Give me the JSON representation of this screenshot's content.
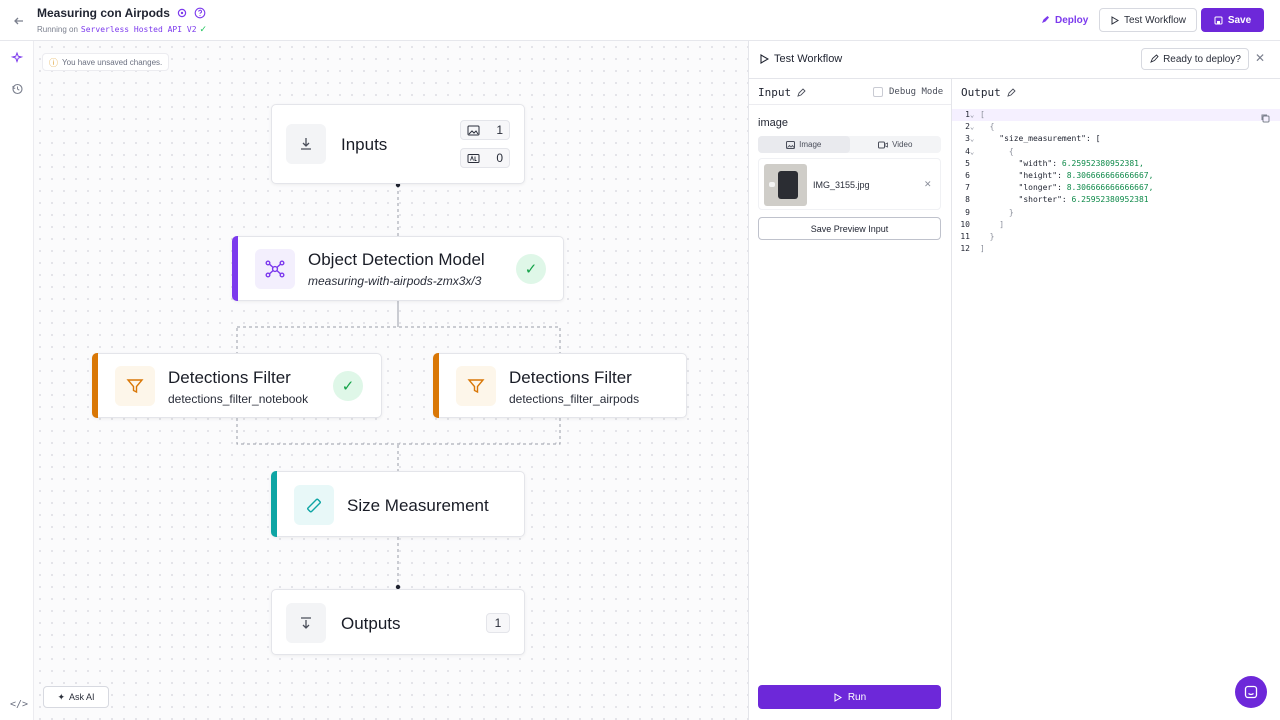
{
  "header": {
    "title": "Measuring con Airpods",
    "running_prefix": "Running on",
    "running_target": "Serverless Hosted API V2",
    "deploy_label": "Deploy",
    "test_label": "Test Workflow",
    "save_label": "Save"
  },
  "canvas": {
    "unsaved_notice": "You have unsaved changes.",
    "ask_ai_label": "Ask AI",
    "code_toggle": "</>",
    "nodes": {
      "inputs": {
        "title": "Inputs",
        "image_count": "1",
        "param_count": "0"
      },
      "model": {
        "title": "Object Detection Model",
        "subtitle": "measuring-with-airpods-zmx3x/3",
        "accent": "#7c3aed"
      },
      "filter_notebook": {
        "title": "Detections Filter",
        "subtitle": "detections_filter_notebook",
        "accent": "#d97706"
      },
      "filter_airpods": {
        "title": "Detections Filter",
        "subtitle": "detections_filter_airpods",
        "accent": "#d97706"
      },
      "size": {
        "title": "Size Measurement",
        "accent": "#0ea5a4"
      },
      "outputs": {
        "title": "Outputs",
        "count": "1"
      }
    }
  },
  "panel": {
    "title": "Test Workflow",
    "ready_label": "Ready to deploy?",
    "input_label": "Input",
    "debug_label": "Debug Mode",
    "output_label": "Output",
    "image_field_label": "image",
    "tabs": [
      "Image",
      "Video"
    ],
    "file_name": "IMG_3155.jpg",
    "save_preview_label": "Save Preview Input",
    "run_label": "Run",
    "output_lines": [
      {
        "n": "1",
        "fold": true,
        "text": "["
      },
      {
        "n": "2",
        "fold": true,
        "text": "  {"
      },
      {
        "n": "3",
        "fold": true,
        "key": "    \"size_measurement\": ["
      },
      {
        "n": "4",
        "fold": true,
        "text": "      {"
      },
      {
        "n": "5",
        "key": "        \"width\": ",
        "num": "6.25952380952381,"
      },
      {
        "n": "6",
        "key": "        \"height\": ",
        "num": "8.306666666666667,"
      },
      {
        "n": "7",
        "key": "        \"longer\": ",
        "num": "8.306666666666667,"
      },
      {
        "n": "8",
        "key": "        \"shorter\": ",
        "num": "6.25952380952381"
      },
      {
        "n": "9",
        "text": "      }"
      },
      {
        "n": "10",
        "text": "    ]"
      },
      {
        "n": "11",
        "text": "  }"
      },
      {
        "n": "12",
        "text": "]"
      }
    ]
  },
  "colors": {
    "brand": "#6d28d9",
    "success": "#16a34a"
  }
}
